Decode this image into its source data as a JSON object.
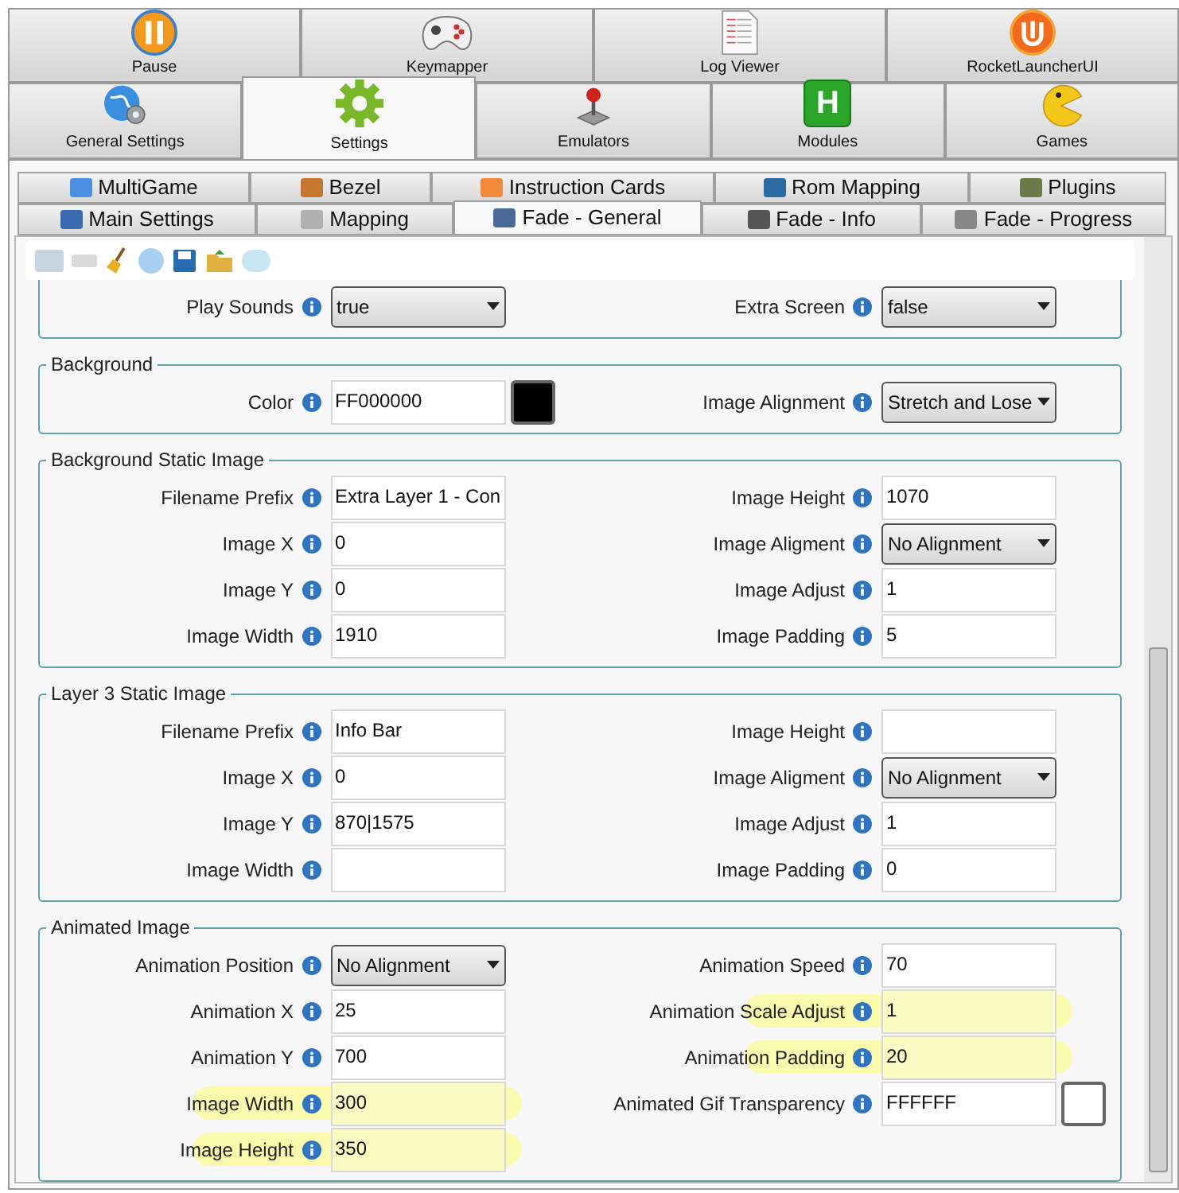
{
  "top_tabs": [
    {
      "label": "Pause",
      "selected": false
    },
    {
      "label": "Keymapper",
      "selected": false
    },
    {
      "label": "Log Viewer",
      "selected": false
    },
    {
      "label": "RocketLauncherUI",
      "selected": false
    }
  ],
  "main_tabs": [
    {
      "label": "General Settings",
      "selected": false
    },
    {
      "label": "Settings",
      "selected": true
    },
    {
      "label": "Emulators",
      "selected": false
    },
    {
      "label": "Modules",
      "selected": false,
      "icon_letter": "H"
    },
    {
      "label": "Games",
      "selected": false
    }
  ],
  "sub_tabs_row1": [
    {
      "label": "MultiGame",
      "selected": false
    },
    {
      "label": "Bezel",
      "selected": false
    },
    {
      "label": "Instruction Cards",
      "selected": false
    },
    {
      "label": "Rom Mapping",
      "selected": false
    },
    {
      "label": "Plugins",
      "selected": false
    }
  ],
  "sub_tabs_row2": [
    {
      "label": "Main Settings",
      "selected": false
    },
    {
      "label": "Mapping",
      "selected": false
    },
    {
      "label": "Fade - General",
      "selected": true
    },
    {
      "label": "Fade - Info",
      "selected": false
    },
    {
      "label": "Fade - Progress",
      "selected": false
    }
  ],
  "groups": [
    {
      "left": [
        {
          "label": "Play Sounds",
          "value": "true",
          "kind": "dropdown",
          "highlighted": false
        }
      ],
      "right": [
        {
          "label": "Extra Screen",
          "value": "false",
          "kind": "dropdown",
          "highlighted": false
        }
      ]
    },
    {
      "title": "Background",
      "left": [
        {
          "label": "Color",
          "value": "FF000000",
          "kind": "color",
          "color": "#000000",
          "highlighted": false
        }
      ],
      "right": [
        {
          "label": "Image Alignment",
          "value": "Stretch and Lose",
          "kind": "dropdown",
          "highlighted": false
        }
      ]
    },
    {
      "title": "Background Static Image",
      "left": [
        {
          "label": "Filename Prefix",
          "value": "Extra Layer 1 - Con",
          "kind": "text",
          "highlighted": false
        },
        {
          "label": "Image X",
          "value": "0",
          "kind": "text",
          "highlighted": false
        },
        {
          "label": "Image Y",
          "value": "0",
          "kind": "text",
          "highlighted": false
        },
        {
          "label": "Image Width",
          "value": "1910",
          "kind": "text",
          "highlighted": false
        }
      ],
      "right": [
        {
          "label": "Image Height",
          "value": "1070",
          "kind": "text",
          "highlighted": false
        },
        {
          "label": "Image Aligment",
          "value": "No Alignment",
          "kind": "dropdown",
          "highlighted": false
        },
        {
          "label": "Image Adjust",
          "value": "1",
          "kind": "text",
          "highlighted": false
        },
        {
          "label": "Image Padding",
          "value": "5",
          "kind": "text",
          "highlighted": false
        }
      ]
    },
    {
      "title": "Layer 3 Static Image",
      "left": [
        {
          "label": "Filename Prefix",
          "value": "Info Bar",
          "kind": "text",
          "highlighted": false
        },
        {
          "label": "Image X",
          "value": "0",
          "kind": "text",
          "highlighted": false
        },
        {
          "label": "Image Y",
          "value": "870|1575",
          "kind": "text",
          "highlighted": false
        },
        {
          "label": "Image Width",
          "kind": "text",
          "highlighted": false
        }
      ],
      "right": [
        {
          "label": "Image Height",
          "kind": "text",
          "highlighted": false
        },
        {
          "label": "Image Aligment",
          "value": "No Alignment",
          "kind": "dropdown",
          "highlighted": false
        },
        {
          "label": "Image Adjust",
          "value": "1",
          "kind": "text",
          "highlighted": false
        },
        {
          "label": "Image Padding",
          "value": "0",
          "kind": "text",
          "highlighted": false
        }
      ]
    },
    {
      "title": "Animated Image",
      "left": [
        {
          "label": "Animation Position",
          "value": "No Alignment",
          "kind": "dropdown",
          "highlighted": false
        },
        {
          "label": "Animation X",
          "value": "25",
          "kind": "text",
          "highlighted": false
        },
        {
          "label": "Animation Y",
          "value": "700",
          "kind": "text",
          "highlighted": false
        },
        {
          "label": "Image Width",
          "value": "300",
          "kind": "text",
          "highlighted": true
        },
        {
          "label": "Image Height",
          "value": "350",
          "kind": "text",
          "highlighted": true
        }
      ],
      "right": [
        {
          "label": "Animation Speed",
          "value": "70",
          "kind": "text",
          "highlighted": false
        },
        {
          "label": "Animation Scale Adjust",
          "value": "1",
          "kind": "text",
          "highlighted": true
        },
        {
          "label": "Animation Padding",
          "value": "20",
          "kind": "text",
          "highlighted": true
        },
        {
          "label": "Animated Gif Transparency",
          "value": "FFFFFF",
          "kind": "color",
          "color": "#ffffff",
          "highlighted": false
        }
      ]
    }
  ]
}
